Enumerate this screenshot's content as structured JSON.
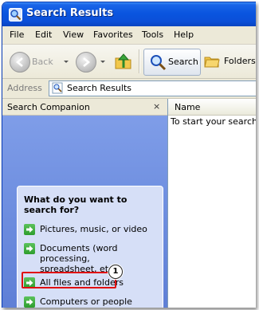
{
  "window": {
    "title": "Search Results",
    "title_icon": "search-magnifier-icon"
  },
  "menubar": {
    "items": [
      "File",
      "Edit",
      "View",
      "Favorites",
      "Tools",
      "Help"
    ]
  },
  "toolbar": {
    "back_label": "Back",
    "search_label": "Search",
    "folders_label": "Folders"
  },
  "address": {
    "label": "Address",
    "value": "Search Results"
  },
  "companion": {
    "title": "Search Companion",
    "close_glyph": "×",
    "question": "What do you want to search for?",
    "options": [
      "Pictures, music, or video",
      "Documents (word processing, spreadsheet, etc.)",
      "All files and folders",
      "Computers or people"
    ]
  },
  "callout": {
    "number": "1",
    "highlighted_option": "All files and folders"
  },
  "results": {
    "column_name": "Name",
    "message": "To start your search,"
  },
  "colors": {
    "title_bar": "#0a55df",
    "companion_bg": "#6f8fe0",
    "panel_bg": "#d6dff7",
    "highlight": "#e01010",
    "option_arrow": "#2d9d2d"
  }
}
